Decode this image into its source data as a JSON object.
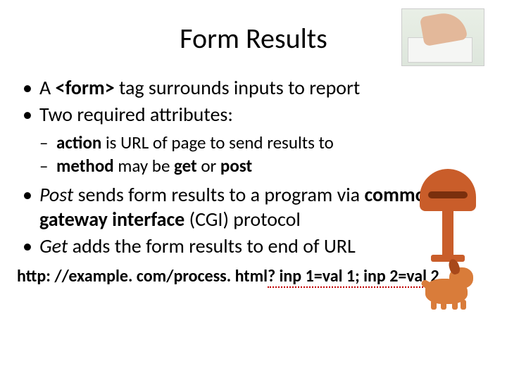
{
  "title": "Form Results",
  "bullets": {
    "b1_pre": "A ",
    "b1_tag": "<form>",
    "b1_post": " tag surrounds inputs to report",
    "b2": "Two required attributes:",
    "s1_kw": "action",
    "s1_post": " is URL of page to send results to",
    "s2_kw": "method",
    "s2_mid": " may be ",
    "s2_get": "get",
    "s2_or": " or ",
    "s2_post": "post",
    "b3_kw": "Post",
    "b3_mid": " sends form results to a program via ",
    "b3_cgi": "common gateway interface",
    "b3_end": " (CGI) protocol",
    "b4_kw": "Get",
    "b4_post": " adds the form results to end of URL"
  },
  "url": {
    "base": "http: //example. com/process. html",
    "query": "? inp 1=val 1; inp 2=val 2"
  }
}
